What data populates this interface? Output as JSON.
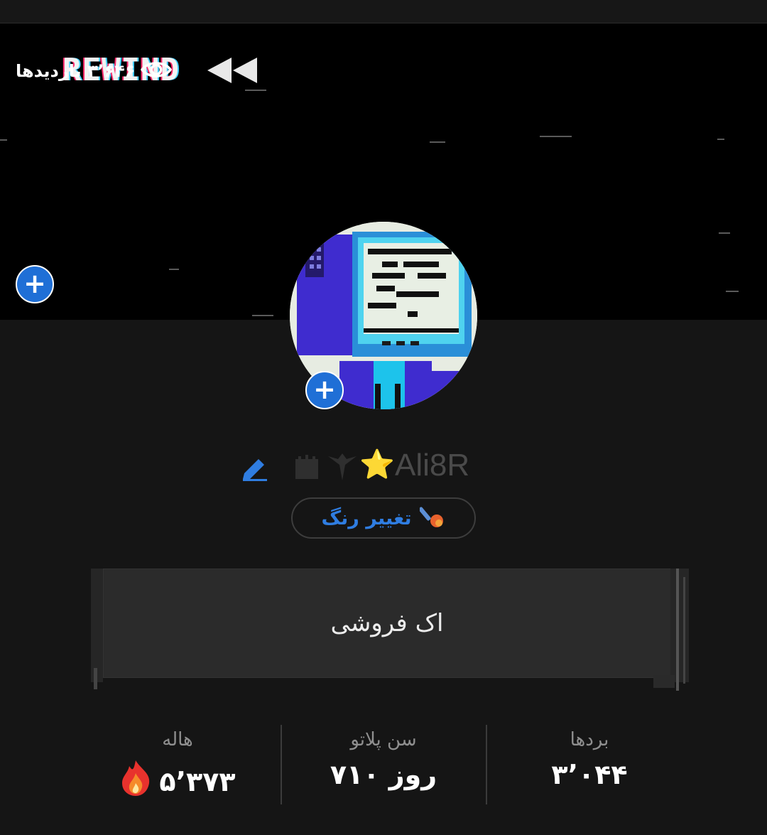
{
  "header": {
    "views_count": "۳٬۶۴۶",
    "views_label": "بازدیدها",
    "banner_text": "REWIND"
  },
  "profile": {
    "display_name": "Ali8R",
    "name_emoji": "⭐",
    "color_button_label": "تغییر رنگ",
    "bio": "اک فروشی"
  },
  "stats": [
    {
      "label": "بردها",
      "value": "۳٬۰۴۴"
    },
    {
      "label": "سن پلاتو",
      "value": "۷۱۰ روز"
    },
    {
      "label": "هاله",
      "value": "۵٬۳۷۳"
    }
  ],
  "colors": {
    "accent": "#1f6fd6",
    "link": "#2f7de1",
    "background": "#151515",
    "banner": "#000000"
  },
  "icons": [
    "eye-icon",
    "plus-icon",
    "edit-icon",
    "brush-icon",
    "fire-icon",
    "star-emoji",
    "bird-icon"
  ]
}
